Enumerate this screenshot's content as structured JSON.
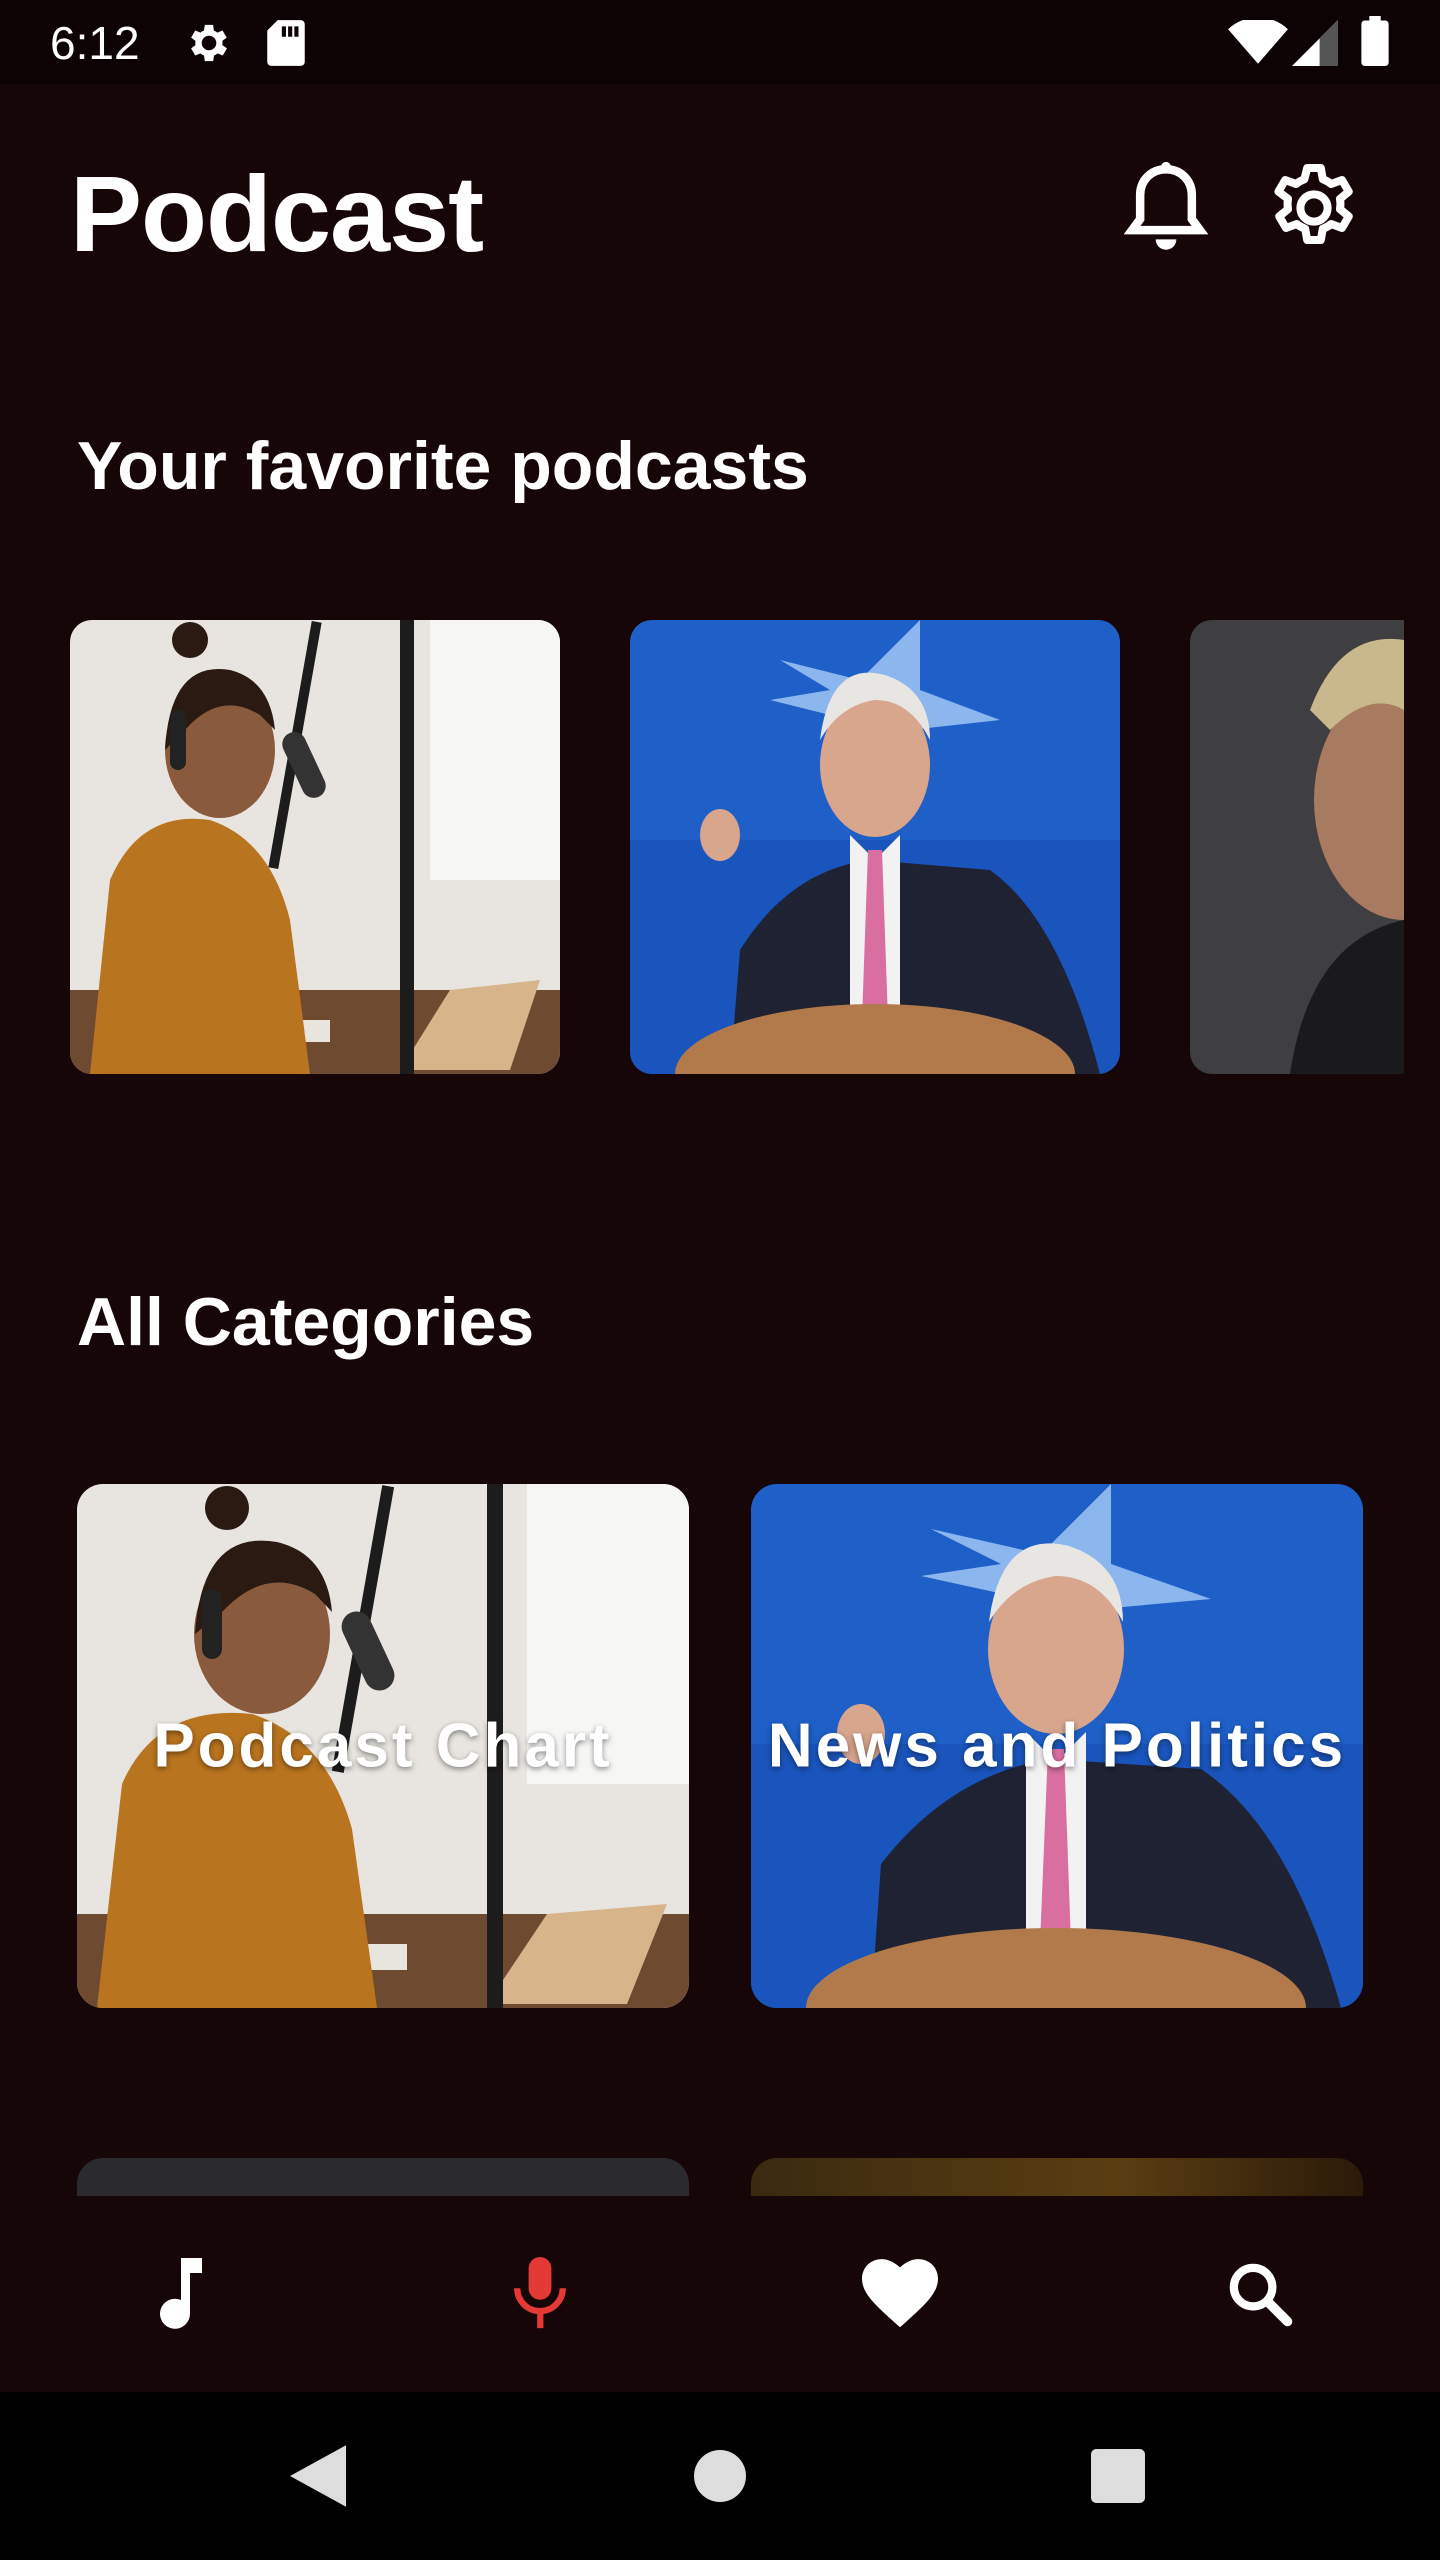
{
  "status_bar": {
    "time": "6:12",
    "icons": [
      "gear-icon",
      "sd-card-icon",
      "wifi-icon",
      "signal-icon",
      "battery-icon"
    ]
  },
  "header": {
    "title": "Podcast",
    "actions": [
      "bell-icon",
      "gear-icon"
    ]
  },
  "favorites": {
    "title": "Your favorite podcasts",
    "items": [
      {
        "image": "woman-with-headphones-at-microphone"
      },
      {
        "image": "man-at-podium-blue-background"
      },
      {
        "image": "man-with-blond-hair-portrait"
      }
    ]
  },
  "categories": {
    "title": "All Categories",
    "items": [
      {
        "label": "Podcast Chart",
        "image": "woman-with-headphones-at-microphone"
      },
      {
        "label": "News and Politics",
        "image": "man-at-podium-blue-background"
      }
    ]
  },
  "bottom_nav": {
    "items": [
      {
        "icon": "music-note-icon",
        "active": false
      },
      {
        "icon": "microphone-icon",
        "active": true
      },
      {
        "icon": "heart-icon",
        "active": false
      },
      {
        "icon": "search-icon",
        "active": false
      }
    ],
    "active_color": "#e53935"
  },
  "system_nav": [
    "back-icon",
    "home-icon",
    "recents-icon"
  ]
}
